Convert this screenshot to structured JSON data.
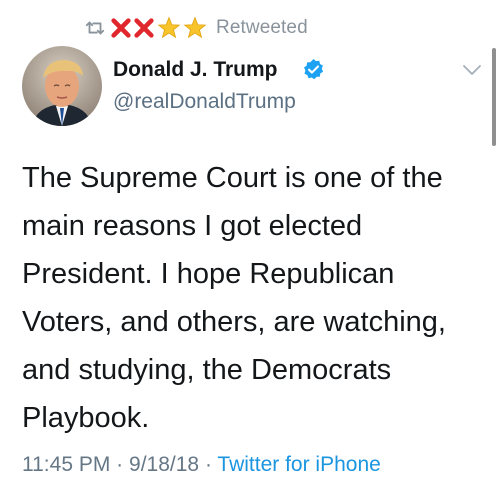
{
  "header": {
    "retweet_label": "Retweeted",
    "retweet_icon": "retweet-icon",
    "emojis": [
      "cross-mark",
      "cross-mark",
      "star",
      "star"
    ]
  },
  "user": {
    "display_name": "Donald J. Trump",
    "handle": "@realDonaldTrump",
    "verified": true,
    "verified_color": "#1da1f2"
  },
  "tweet": {
    "text": "The Supreme Court is one of the\nmain reasons I got elected\nPresident. I hope Republican\nVoters, and others, are watching,\nand studying, the Democrats\nPlaybook.",
    "time": "11:45 PM",
    "date": "9/18/18",
    "separator": "·",
    "source": "Twitter for iPhone"
  },
  "colors": {
    "muted": "#657786",
    "link": "#1b95e0",
    "emoji_red": "#e0272d",
    "emoji_star": "#f7c42c"
  }
}
